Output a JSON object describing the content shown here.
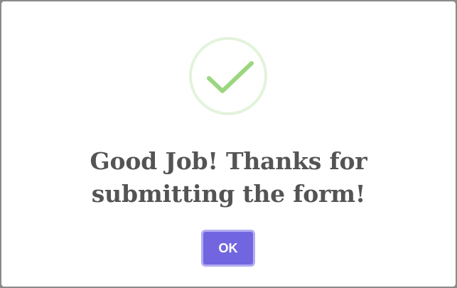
{
  "dialog": {
    "icon": "checkmark-success-icon",
    "title": "Good Job! Thanks for submitting the form!",
    "ok_label": "OK"
  },
  "colors": {
    "check": "#9bd67f",
    "ring": "#e3f3dc",
    "button": "#7266e0",
    "button_border": "#b4acf0",
    "title_text": "#545454"
  }
}
